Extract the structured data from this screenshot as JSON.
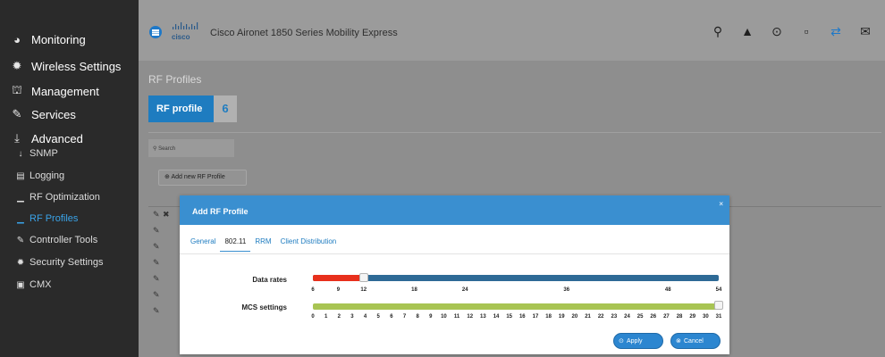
{
  "sidebar": {
    "items": [
      {
        "label": "Monitoring",
        "icon": "dashboard-icon",
        "glyph": "◕"
      },
      {
        "label": "Wireless Settings",
        "icon": "gear-icon",
        "glyph": "✹"
      },
      {
        "label": "Management",
        "icon": "management-icon",
        "glyph": "⛫"
      },
      {
        "label": "Services",
        "icon": "wrench-icon",
        "glyph": "✎"
      },
      {
        "label": "Advanced",
        "icon": "download-icon",
        "glyph": "⤓"
      }
    ],
    "subitems": [
      {
        "label": "SNMP",
        "icon": "snmp-icon",
        "glyph": "↓"
      },
      {
        "label": "Logging",
        "icon": "logging-icon",
        "glyph": "▤"
      },
      {
        "label": "RF Optimization",
        "icon": "signal-icon",
        "glyph": "▁"
      },
      {
        "label": "RF Profiles",
        "icon": "signal-icon",
        "glyph": "▁"
      },
      {
        "label": "Controller Tools",
        "icon": "wrench-icon",
        "glyph": "✎"
      },
      {
        "label": "Security Settings",
        "icon": "gear-icon",
        "glyph": "✹"
      },
      {
        "label": "CMX",
        "icon": "cmx-icon",
        "glyph": "▣"
      }
    ]
  },
  "topbar": {
    "brand": "cisco",
    "title": "Cisco Aironet 1850 Series Mobility Express",
    "icons": [
      "search-icon",
      "alert-icon",
      "download-icon",
      "save-icon",
      "transfer-icon",
      "mail-icon"
    ]
  },
  "page": {
    "title": "RF Profiles",
    "badge_label": "RF profile",
    "badge_count": "6",
    "search_placeholder": "Search",
    "add_label": "Add new RF Profile"
  },
  "modal": {
    "title": "Add RF Profile",
    "close": "×",
    "tabs": [
      "General",
      "802.11",
      "RRM",
      "Client Distribution"
    ],
    "active_tab": "802.11",
    "data_rates": {
      "label": "Data rates",
      "ticks": [
        "6",
        "9",
        "12",
        "18",
        "24",
        "36",
        "48",
        "54"
      ],
      "min": 6,
      "max": 54,
      "selected_upto": 12,
      "disabled_color": "#e8301c",
      "enabled_color": "#2e6a96"
    },
    "mcs": {
      "label": "MCS settings",
      "ticks": [
        "0",
        "1",
        "2",
        "3",
        "4",
        "5",
        "6",
        "7",
        "8",
        "9",
        "10",
        "11",
        "12",
        "13",
        "14",
        "15",
        "16",
        "17",
        "18",
        "19",
        "20",
        "21",
        "22",
        "23",
        "24",
        "25",
        "26",
        "27",
        "28",
        "29",
        "30",
        "31"
      ],
      "max": 31,
      "selected_upto": 31,
      "color": "#a8c453"
    },
    "apply_label": "Apply",
    "cancel_label": "Cancel"
  }
}
